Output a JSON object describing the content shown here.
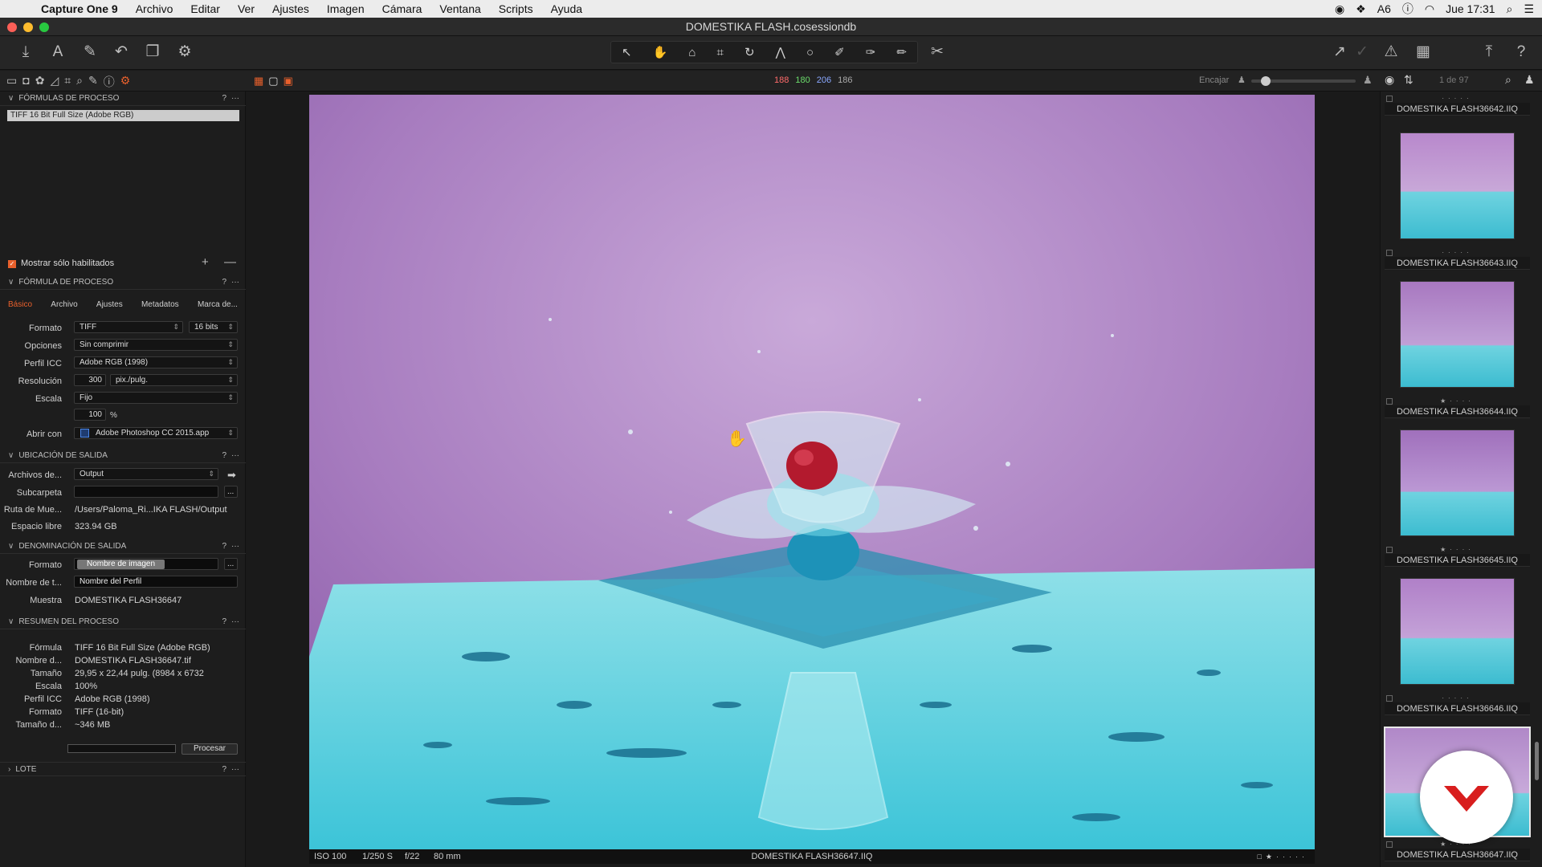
{
  "menubar": {
    "app_name": "Capture One 9",
    "menus": [
      "Archivo",
      "Editar",
      "Ver",
      "Ajustes",
      "Imagen",
      "Cámara",
      "Ventana",
      "Scripts",
      "Ayuda"
    ],
    "status_count": "6",
    "clock": "Jue 17:31"
  },
  "window": {
    "title": "DOMESTIKA FLASH.cosessiondb"
  },
  "colors": {
    "accent": "#e8602c",
    "panel": "#1d1d1d",
    "brand_logo": "#d81e1e"
  },
  "viewer": {
    "rgb": {
      "r": "188",
      "g": "180",
      "b": "206",
      "l": "186"
    },
    "fit_label": "Encajar",
    "count": "1 de 97",
    "info": {
      "iso": "ISO 100",
      "shutter": "1/250 S",
      "aperture": "f/22",
      "focal": "80 mm",
      "filename": "DOMESTIKA FLASH36647.IIQ"
    }
  },
  "left": {
    "recipes_header": "FÓRMULAS DE PROCESO",
    "recipe_item": "TIFF 16 Bit Full Size (Adobe RGB)",
    "show_enabled": "Mostrar sólo habilitados",
    "recipe_header": "FÓRMULA DE PROCESO",
    "tabs": [
      "Básico",
      "Archivo",
      "Ajustes",
      "Metadatos",
      "Marca de..."
    ],
    "fields": {
      "format_label": "Formato",
      "format_value": "TIFF",
      "bits_value": "16 bits",
      "options_label": "Opciones",
      "options_value": "Sin comprimir",
      "icc_label": "Perfil ICC",
      "icc_value": "Adobe RGB (1998)",
      "res_label": "Resolución",
      "res_value": "300",
      "res_unit": "pix./pulg.",
      "scale_label": "Escala",
      "scale_value": "Fijo",
      "scale_pct": "100",
      "pct_sign": "%",
      "open_label": "Abrir con",
      "open_value": "Adobe Photoshop CC 2015.app"
    },
    "output_header": "UBICACIÓN DE SALIDA",
    "output": {
      "files_label": "Archivos de...",
      "files_value": "Output",
      "sub_label": "Subcarpeta",
      "path_label": "Ruta de Mue...",
      "path_value": "/Users/Paloma_Ri...IKA FLASH/Output",
      "space_label": "Espacio libre",
      "space_value": "323.94 GB"
    },
    "naming_header": "DENOMINACIÓN DE SALIDA",
    "naming": {
      "format_label": "Formato",
      "format_token": "Nombre de imagen",
      "job_label": "Nombre de t...",
      "job_value": "Nombre del Perfil",
      "sample_label": "Muestra",
      "sample_value": "DOMESTIKA FLASH36647"
    },
    "summary_header": "RESUMEN DEL PROCESO",
    "summary": [
      {
        "label": "Fórmula",
        "value": "TIFF 16 Bit Full Size (Adobe RGB)"
      },
      {
        "label": "Nombre d...",
        "value": "DOMESTIKA FLASH36647.tif"
      },
      {
        "label": "Tamaño",
        "value": "29,95 x 22,44 pulg. (8984 x 6732"
      },
      {
        "label": "Escala",
        "value": "100%"
      },
      {
        "label": "Perfil ICC",
        "value": "Adobe RGB (1998)"
      },
      {
        "label": "Formato",
        "value": "TIFF (16-bit)"
      },
      {
        "label": "Tamaño d...",
        "value": "~346 MB"
      }
    ],
    "process_button": "Procesar",
    "batch_header": "LOTE"
  },
  "browser": {
    "thumbs": [
      {
        "name": "DOMESTIKA FLASH36642.IIQ"
      },
      {
        "name": "DOMESTIKA FLASH36643.IIQ"
      },
      {
        "name": "DOMESTIKA FLASH36644.IIQ"
      },
      {
        "name": "DOMESTIKA FLASH36645.IIQ"
      },
      {
        "name": "DOMESTIKA FLASH36646.IIQ"
      },
      {
        "name": "DOMESTIKA FLASH36647.IIQ"
      }
    ]
  }
}
